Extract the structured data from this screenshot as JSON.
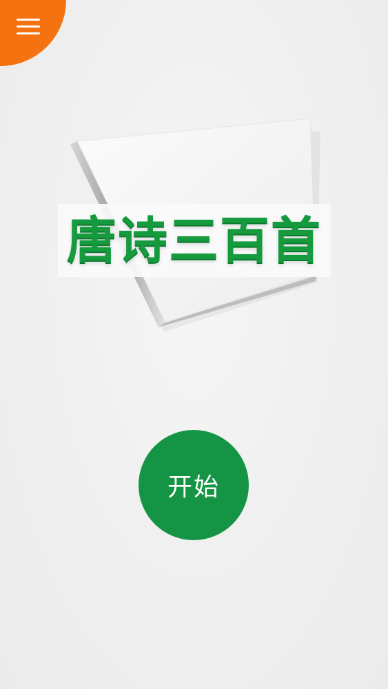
{
  "header": {
    "menu_icon": "hamburger-menu-icon",
    "menu_color": "#f4720f"
  },
  "cover": {
    "title": "唐诗三百首",
    "title_color": "#159a3e"
  },
  "main": {
    "start_label": "开始",
    "start_color": "#149444"
  }
}
